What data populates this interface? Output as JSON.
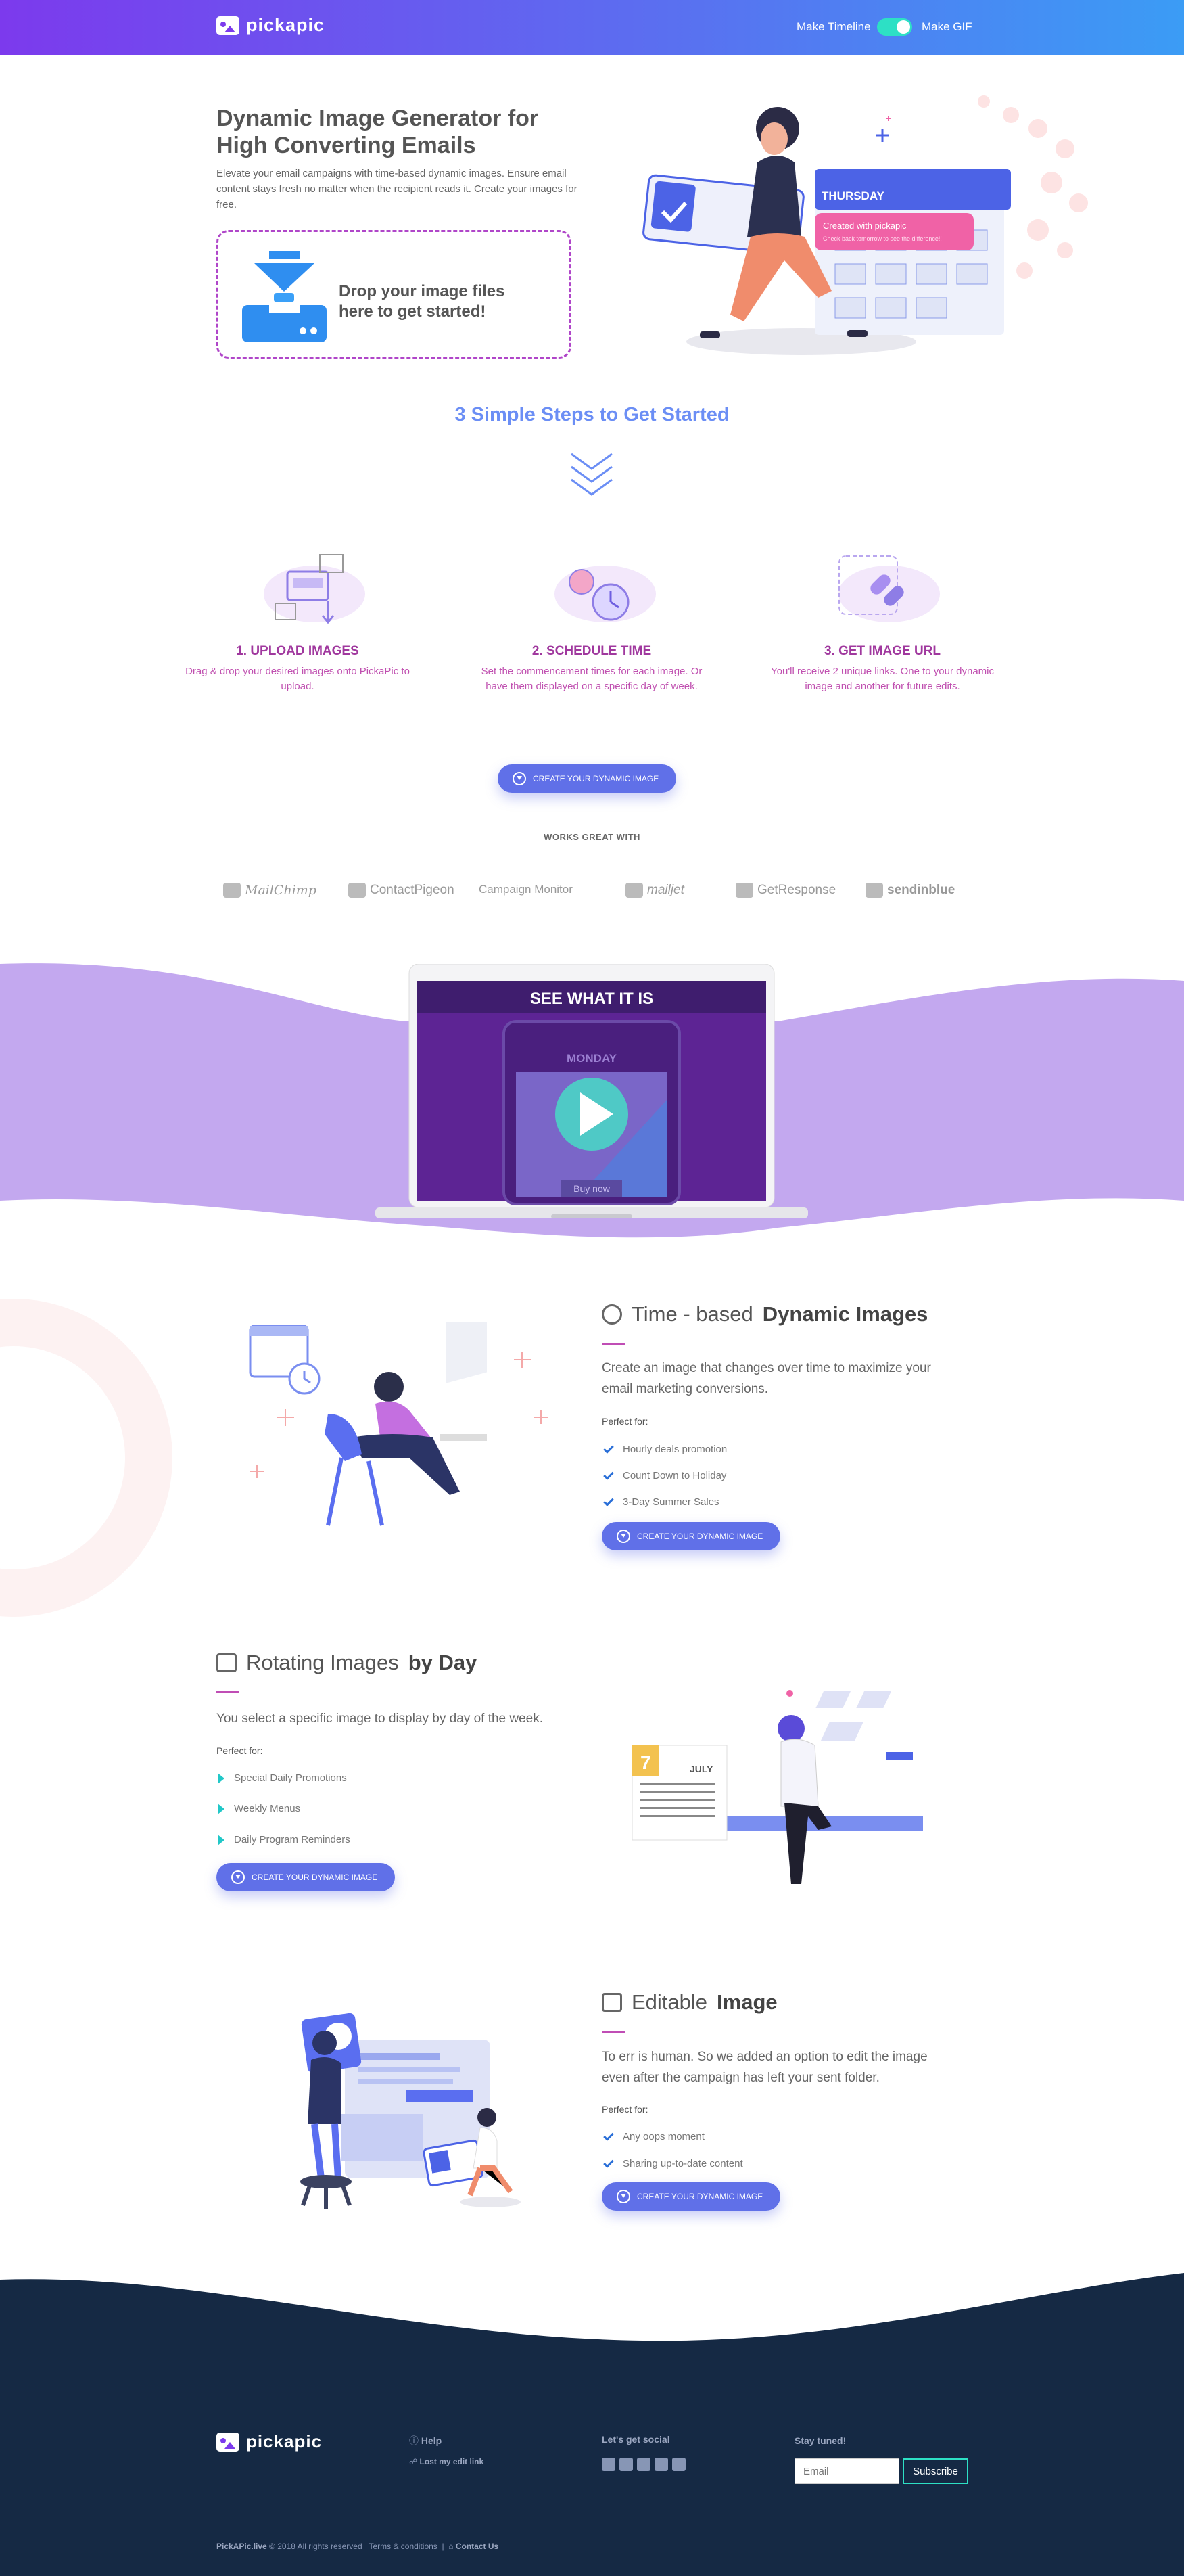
{
  "header": {
    "brand": "pickapic",
    "toggle_left": "Make Timeline",
    "toggle_right": "Make GIF"
  },
  "hero": {
    "title": "Dynamic Image Generator for High Converting Emails",
    "description": "Elevate your email campaigns with time-based dynamic images. Ensure email content stays fresh no matter when the recipient reads it. Create your images for free.",
    "drop_text": "Drop your image files here to get started!",
    "calendar_day": "THURSDAY",
    "badge_created": "Created with",
    "badge_brand": "pickapic",
    "badge_sub": "Check back tomorrow to see the difference!!"
  },
  "steps": {
    "title": "3 Simple Steps to Get Started",
    "items": [
      {
        "title": "1. UPLOAD IMAGES",
        "text": "Drag & drop your desired images onto PickaPic to upload."
      },
      {
        "title": "2. SCHEDULE TIME",
        "text": "Set the commencement times for each image. Or have them displayed on a specific day of week."
      },
      {
        "title": "3. GET IMAGE URL",
        "text": "You'll receive 2 unique links. One to your dynamic image and another for future edits."
      }
    ],
    "cta": "CREATE YOUR DYNAMIC IMAGE"
  },
  "works": {
    "label": "WORKS GREAT WITH",
    "brands": [
      "MailChimp",
      "ContactPigeon",
      "Campaign Monitor",
      "mailjet",
      "GetResponse",
      "sendinblue"
    ]
  },
  "video": {
    "title": "SEE WHAT IT IS",
    "screen_day": "MONDAY",
    "screen_button": "Buy now"
  },
  "feature_time": {
    "title_light": "Time - based",
    "title_bold": "Dynamic Images",
    "text": "Create an image that changes over time to maximize your email marketing conversions.",
    "perfect": "Perfect for:",
    "items": [
      "Hourly deals promotion",
      "Count Down to Holiday",
      "3-Day Summer Sales"
    ],
    "cta": "CREATE YOUR DYNAMIC IMAGE"
  },
  "feature_rotate": {
    "title_light": "Rotating Images",
    "title_bold": "by Day",
    "text": "You select a specific image to display by day of the week.",
    "perfect": "Perfect for:",
    "items": [
      "Special Daily Promotions",
      "Weekly Menus",
      "Daily Program Reminders"
    ],
    "cta": "CREATE YOUR DYNAMIC IMAGE",
    "calendar_num": "7",
    "calendar_month": "JULY"
  },
  "feature_edit": {
    "title_light": "Editable",
    "title_bold": "Image",
    "text": "To err is human. So we added an option to edit the image even after the campaign has left your sent folder.",
    "perfect": "Perfect for:",
    "items": [
      "Any oops moment",
      "Sharing up-to-date content"
    ],
    "cta": "CREATE YOUR DYNAMIC IMAGE"
  },
  "footer": {
    "brand": "pickapic",
    "help": "Help",
    "lost": "Lost my edit link",
    "social_title": "Let's get social",
    "stay": "Stay tuned!",
    "email_placeholder": "Email",
    "subscribe": "Subscribe",
    "copy_brand": "PickAPic.live",
    "copy": "© 2018 All rights reserved",
    "terms": "Terms & conditions",
    "contact": "Contact Us"
  },
  "colors": {
    "accent": "#6070e8",
    "magenta": "#a0389e",
    "teal": "#2de0c5",
    "footer_bg": "#152944",
    "wave": "#c3a8ef"
  }
}
